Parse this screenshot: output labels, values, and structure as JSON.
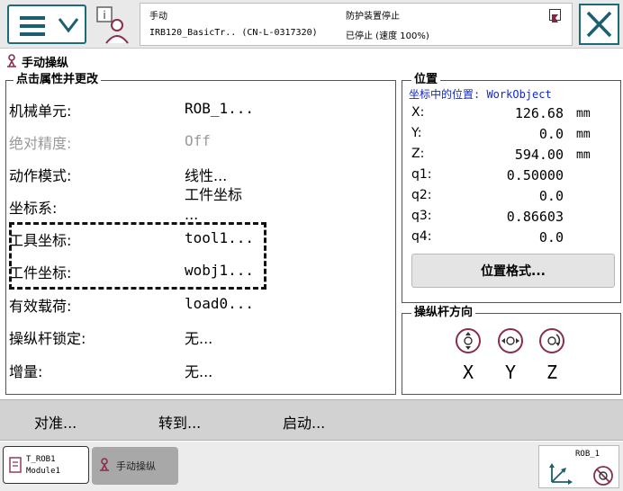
{
  "topbar": {
    "status": {
      "mode": "手动",
      "system": "IRB120_BasicTr.. (CN-L-0317320)",
      "safety": "防护装置停止",
      "state": "已停止 (速度 100%)"
    }
  },
  "app": {
    "title": "手动操纵"
  },
  "properties": {
    "legend": "点击属性并更改",
    "rows": [
      {
        "label": "机械单元:",
        "value": "ROB_1...",
        "enabled": true
      },
      {
        "label": "绝对精度:",
        "value": "Off",
        "enabled": false
      },
      {
        "label": "动作模式:",
        "value": "线性...",
        "enabled": true
      },
      {
        "label": "坐标系:",
        "value": "工件坐标 ...",
        "enabled": true
      },
      {
        "label": "工具坐标:",
        "value": "tool1...",
        "enabled": true
      },
      {
        "label": "工件坐标:",
        "value": "wobj1...",
        "enabled": true
      },
      {
        "label": "有效载荷:",
        "value": "load0...",
        "enabled": true
      },
      {
        "label": "操纵杆锁定:",
        "value": "无...",
        "enabled": true
      },
      {
        "label": "增量:",
        "value": "无...",
        "enabled": true
      }
    ]
  },
  "position": {
    "legend": "位置",
    "frame_label": "坐标中的位置: WorkObject",
    "rows": [
      {
        "label": "X:",
        "value": "126.68",
        "unit": "mm"
      },
      {
        "label": "Y:",
        "value": "0.0",
        "unit": "mm"
      },
      {
        "label": "Z:",
        "value": "594.00",
        "unit": "mm"
      },
      {
        "label": "q1:",
        "value": "0.50000",
        "unit": ""
      },
      {
        "label": "q2:",
        "value": "0.0",
        "unit": ""
      },
      {
        "label": "q3:",
        "value": "0.86603",
        "unit": ""
      },
      {
        "label": "q4:",
        "value": "0.0",
        "unit": ""
      }
    ],
    "format_button": "位置格式..."
  },
  "joystick": {
    "legend": "操纵杆方向",
    "axes": [
      "X",
      "Y",
      "Z"
    ]
  },
  "actions": [
    "对准...",
    "转到...",
    "启动..."
  ],
  "taskbar": {
    "tasks": [
      {
        "line1": "T_ROB1",
        "line2": "Module1"
      },
      {
        "label": "手动操纵"
      }
    ],
    "quickset": {
      "label": "ROB_1"
    }
  },
  "colors": {
    "accent": "#1b6b78",
    "frame_text": "#1428c8"
  }
}
